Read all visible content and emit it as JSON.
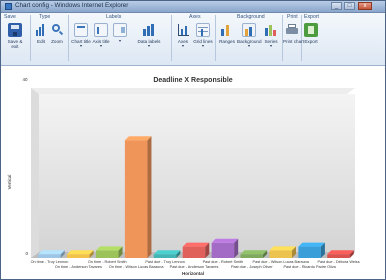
{
  "window": {
    "title": "Chart config - Windows Internet Explorer",
    "minimize_glyph": "_",
    "maximize_glyph": "□",
    "close_glyph": "x"
  },
  "ribbon": {
    "groups": [
      {
        "label": "Save"
      },
      {
        "label": "Type"
      },
      {
        "label": "Labels"
      },
      {
        "label": "Axes"
      },
      {
        "label": "Background"
      },
      {
        "label": "Print"
      },
      {
        "label": "Export"
      }
    ],
    "buttons": [
      {
        "label": "Save &\nexit",
        "icon": "save-icon"
      },
      {
        "label": "Edit",
        "icon": "edit-chart-icon"
      },
      {
        "label": "Zoom",
        "icon": "zoom-icon"
      },
      {
        "label": "Chart title",
        "icon": "chart-title-icon",
        "caret": "▾"
      },
      {
        "label": "Axis title",
        "icon": "axis-title-icon",
        "caret": "▾"
      },
      {
        "label": "",
        "icon": "legend-icon",
        "caret": "▾"
      },
      {
        "label": "Data labels",
        "icon": "data-labels-icon",
        "caret": "▾"
      },
      {
        "label": "Axes",
        "icon": "axes-icon",
        "caret": "▾"
      },
      {
        "label": "Grid lines",
        "icon": "gridlines-icon",
        "caret": "▾"
      },
      {
        "label": "Ranges",
        "icon": "ranges-icon"
      },
      {
        "label": "Background",
        "icon": "background-icon",
        "caret": "▾"
      },
      {
        "label": "Series",
        "icon": "series-icon",
        "caret": "▾"
      },
      {
        "label": "Print chart",
        "icon": "print-icon"
      },
      {
        "label": "Export",
        "icon": "export-icon"
      }
    ]
  },
  "chart_data": {
    "type": "bar",
    "title": "Deadline X Responsible",
    "xlabel": "Horizontal",
    "ylabel": "Vertical",
    "y_tick_top": "40",
    "y_tick_bottom": "0",
    "ylim": [
      0,
      40
    ],
    "categories": [
      "On time - Troy Lennon",
      "On time - Anderson Tavares",
      "On time - Robert Smith",
      "On time - Wilson Lucas Barauna",
      "Past due - Troy Lennon",
      "Past due - Anderson Tavares",
      "Past due - Robert Smith",
      "Past due - Joseph Oliver",
      "Past due - Wilson Lucas Barauna",
      "Past due - Ricardo Padre Oliva",
      "Past due - Débora Weiss"
    ],
    "values": [
      1,
      1,
      2,
      31,
      1,
      3,
      4,
      1,
      2,
      3,
      1
    ],
    "colors": [
      "#9dc6e6",
      "#f2c24a",
      "#9cc25a",
      "#f0955a",
      "#43b5b5",
      "#e0605c",
      "#a46bc6",
      "#7fa95c",
      "#ecc34e",
      "#3a9ed8",
      "#d9534f"
    ]
  }
}
